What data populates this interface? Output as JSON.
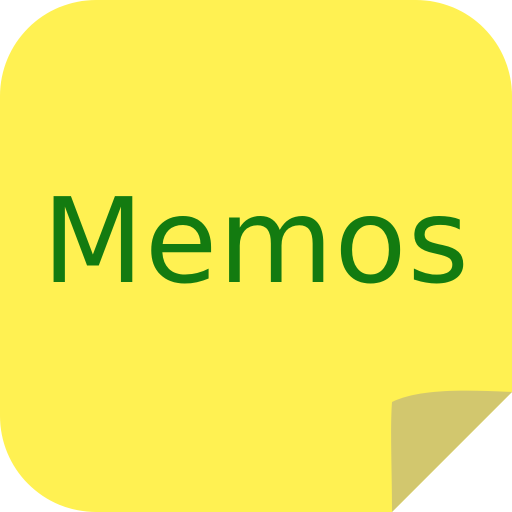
{
  "app": {
    "title": "Memos"
  },
  "colors": {
    "note": "#fff152",
    "fold": "#d2c76e",
    "text": "#137b10"
  },
  "icons": {
    "app_icon": "sticky-note-icon",
    "corner": "page-curl-icon"
  }
}
